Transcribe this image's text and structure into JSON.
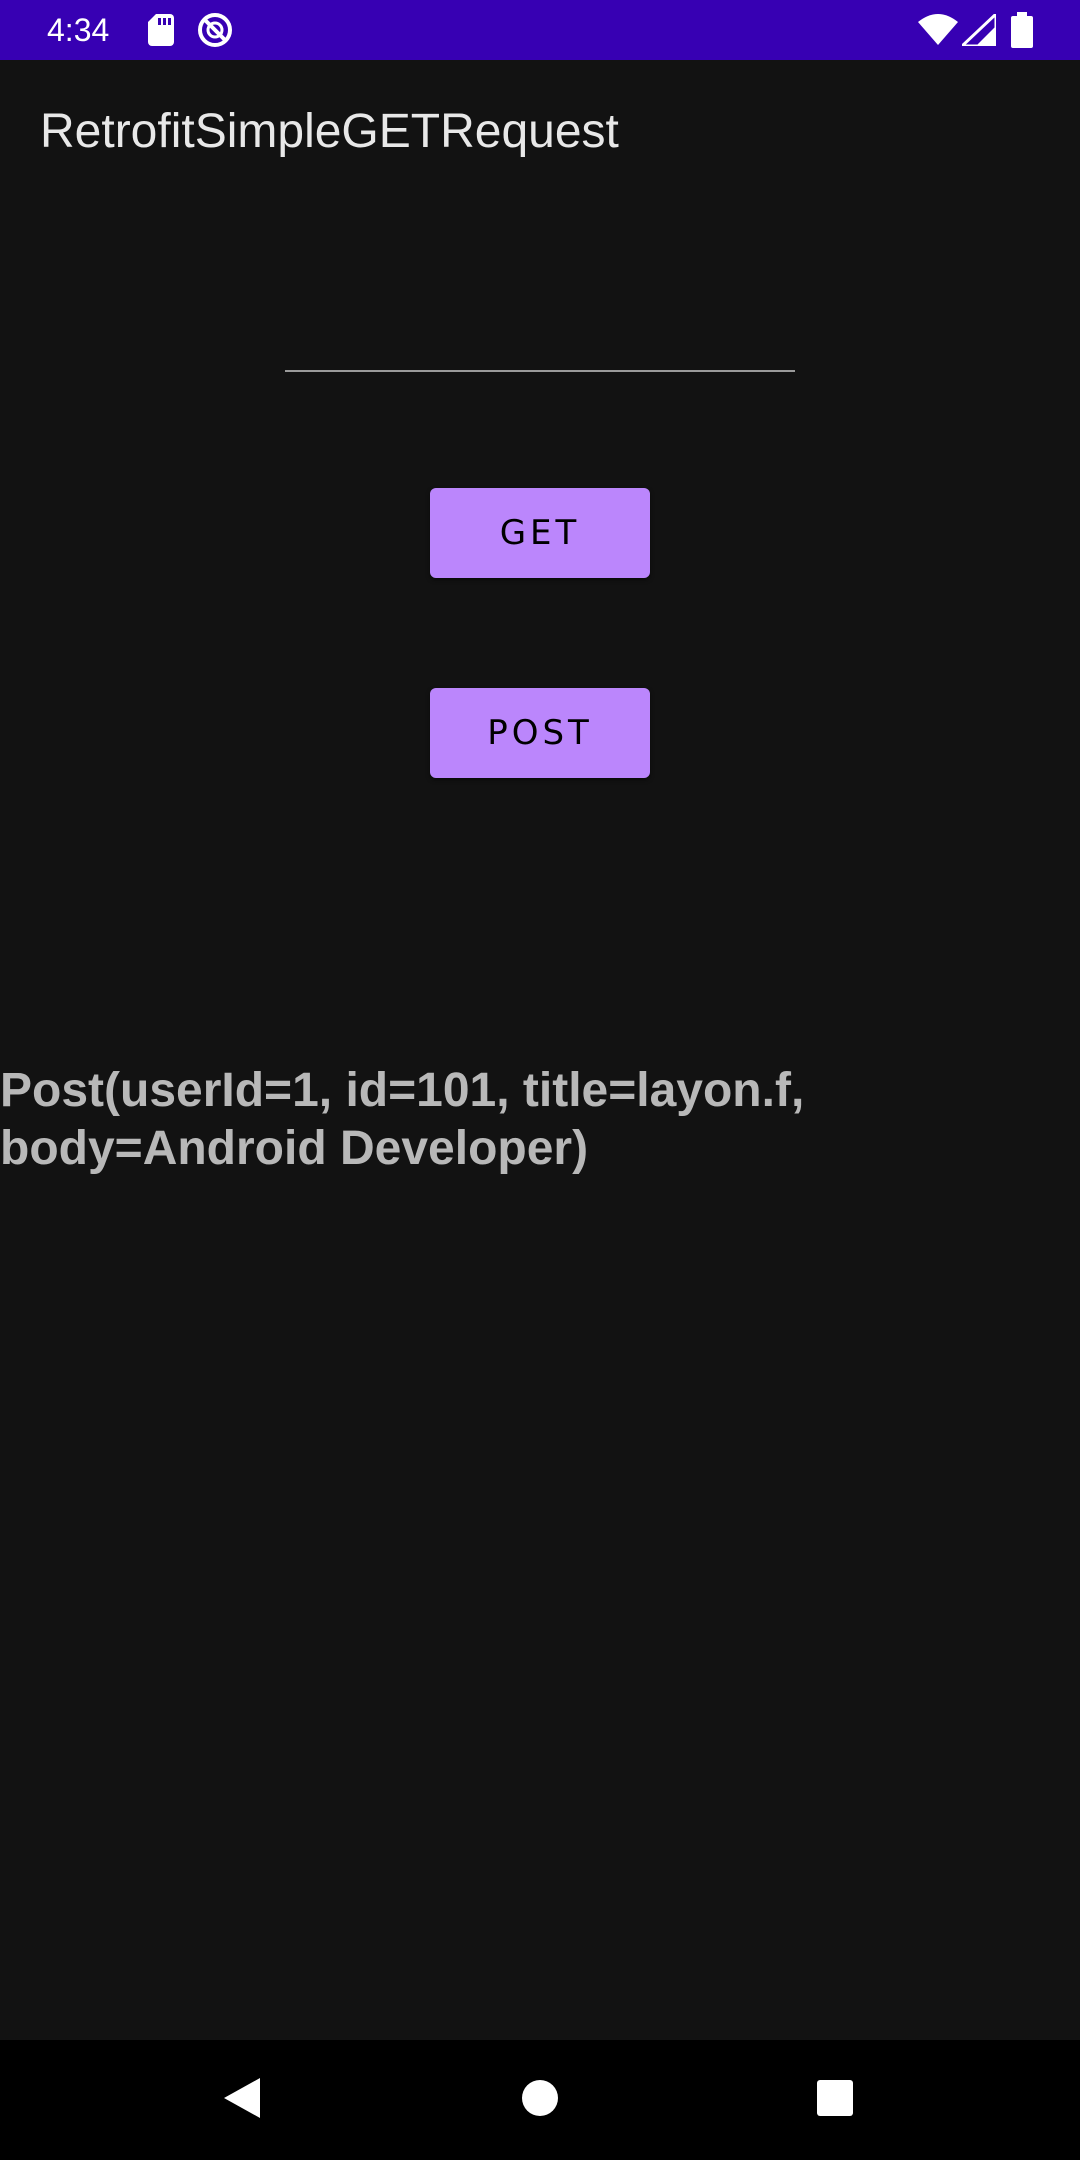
{
  "status_bar": {
    "time": "4:34",
    "left_icons": [
      "sd-card-icon",
      "no-disturb-icon"
    ],
    "right_icons": [
      "wifi-icon",
      "signal-icon",
      "battery-icon"
    ],
    "background": "#3700B3"
  },
  "app_bar": {
    "title": "RetrofitSimpleGETRequest"
  },
  "form": {
    "input_value": "",
    "input_placeholder": ""
  },
  "buttons": {
    "get_label": "GET",
    "post_label": "POST",
    "accent": "#BB86FC"
  },
  "result": {
    "text": "Post(userId=1, id=101, title=layon.f, body=Android Developer)"
  },
  "nav_bar": {
    "icons": [
      "back-icon",
      "home-icon",
      "recents-icon"
    ]
  }
}
